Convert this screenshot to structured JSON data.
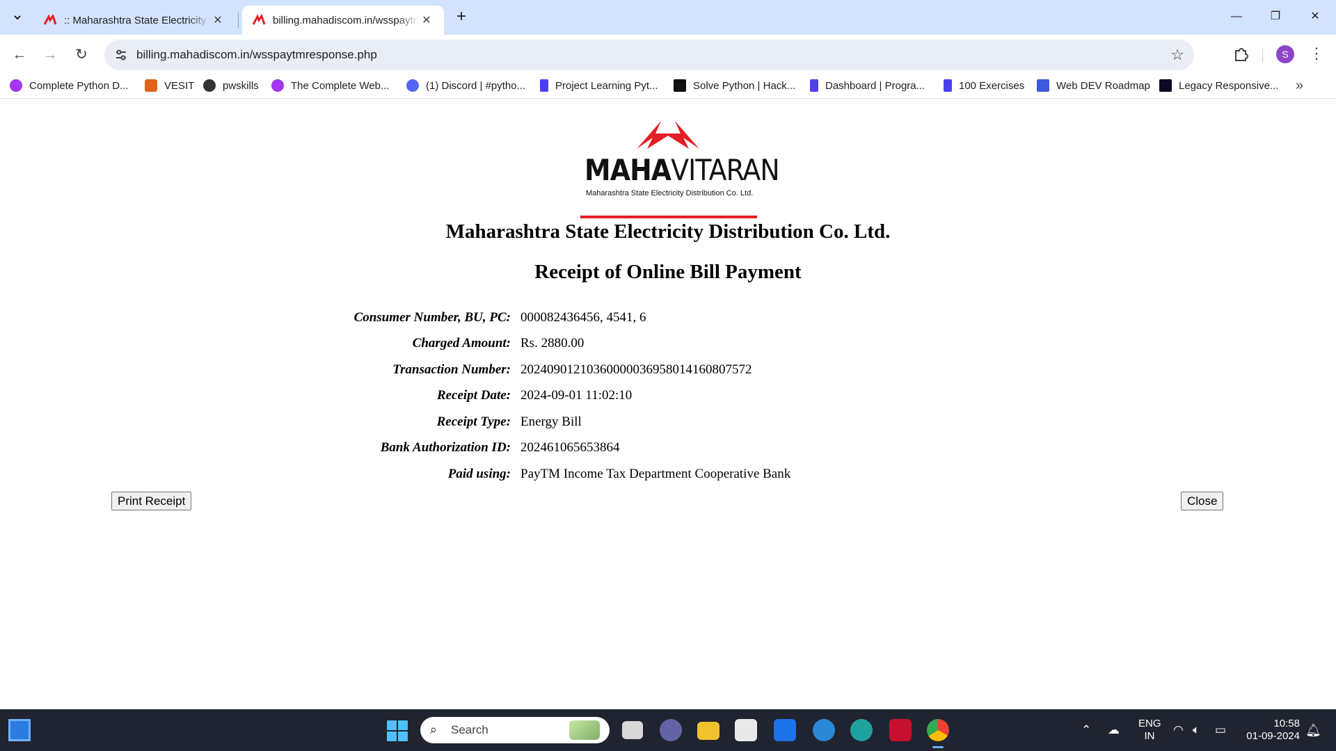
{
  "browser": {
    "tabs": [
      {
        "title": ":: Maharashtra State Electricity D",
        "active": false
      },
      {
        "title": "billing.mahadiscom.in/wsspaytm",
        "active": true
      }
    ],
    "url": "billing.mahadiscom.in/wsspaytmresponse.php",
    "profile_initial": "S",
    "bookmarks": [
      {
        "label": "Complete Python D...",
        "icon": "udemy-icon",
        "color": "#a435f0"
      },
      {
        "label": "VESIT",
        "icon": "vesit-icon",
        "color": "#e0641c"
      },
      {
        "label": "pwskills",
        "icon": "pwskills-icon",
        "color": "#333333"
      },
      {
        "label": "The Complete Web...",
        "icon": "udemy-icon",
        "color": "#a435f0"
      },
      {
        "label": "(1) Discord | #pytho...",
        "icon": "discord-icon",
        "color": "#5865f2"
      },
      {
        "label": "Project Learning Pyt...",
        "icon": "p-icon",
        "color": "#4c3ff0"
      },
      {
        "label": "Solve Python | Hack...",
        "icon": "hackerrank-icon",
        "color": "#111111"
      },
      {
        "label": "Dashboard | Progra...",
        "icon": "p-icon",
        "color": "#4c3ff0"
      },
      {
        "label": "100 Exercises",
        "icon": "p-icon",
        "color": "#4c3ff0"
      },
      {
        "label": "Web DEV Roadmap",
        "icon": "roadmap-icon",
        "color": "#3b5bdb"
      },
      {
        "label": "Legacy Responsive...",
        "icon": "freecodecamp-icon",
        "color": "#0a0a23"
      }
    ]
  },
  "logo": {
    "brand_bold": "MAHA",
    "brand_regular": "VITARAN",
    "subtitle": "Maharashtra State Electricity Distribution Co. Ltd.",
    "accent_color": "#e31e24"
  },
  "page": {
    "org_title": "Maharashtra State Electricity Distribution Co. Ltd.",
    "receipt_title": "Receipt of Online Bill Payment",
    "fields": [
      {
        "label": "Consumer Number, BU, PC:",
        "value": "000082436456, 4541, 6"
      },
      {
        "label": "Charged Amount:",
        "value": "Rs. 2880.00"
      },
      {
        "label": "Transaction Number:",
        "value": "20240901210360000036958014160807572"
      },
      {
        "label": "Receipt Date:",
        "value": "2024-09-01 11:02:10"
      },
      {
        "label": "Receipt Type:",
        "value": "Energy Bill"
      },
      {
        "label": "Bank Authorization ID:",
        "value": "202461065653864"
      },
      {
        "label": "Paid using:",
        "value": "PayTM Income Tax Department Cooperative Bank"
      }
    ],
    "print_button": "Print Receipt",
    "close_button": "Close"
  },
  "taskbar": {
    "search_placeholder": "Search",
    "language": "ENG",
    "region": "IN",
    "time": "10:58",
    "date": "01-09-2024"
  }
}
